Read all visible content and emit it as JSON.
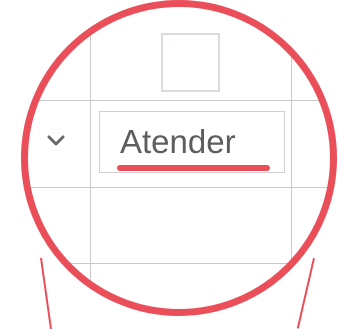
{
  "status_field": {
    "value": "Atender"
  },
  "icons": {
    "dropdown": "chevron-down-icon"
  },
  "colors": {
    "highlight": "#ea4e58",
    "text": "#5e5e5e",
    "grid": "#c9c9c9",
    "checkbox_border": "#dedbd6"
  }
}
